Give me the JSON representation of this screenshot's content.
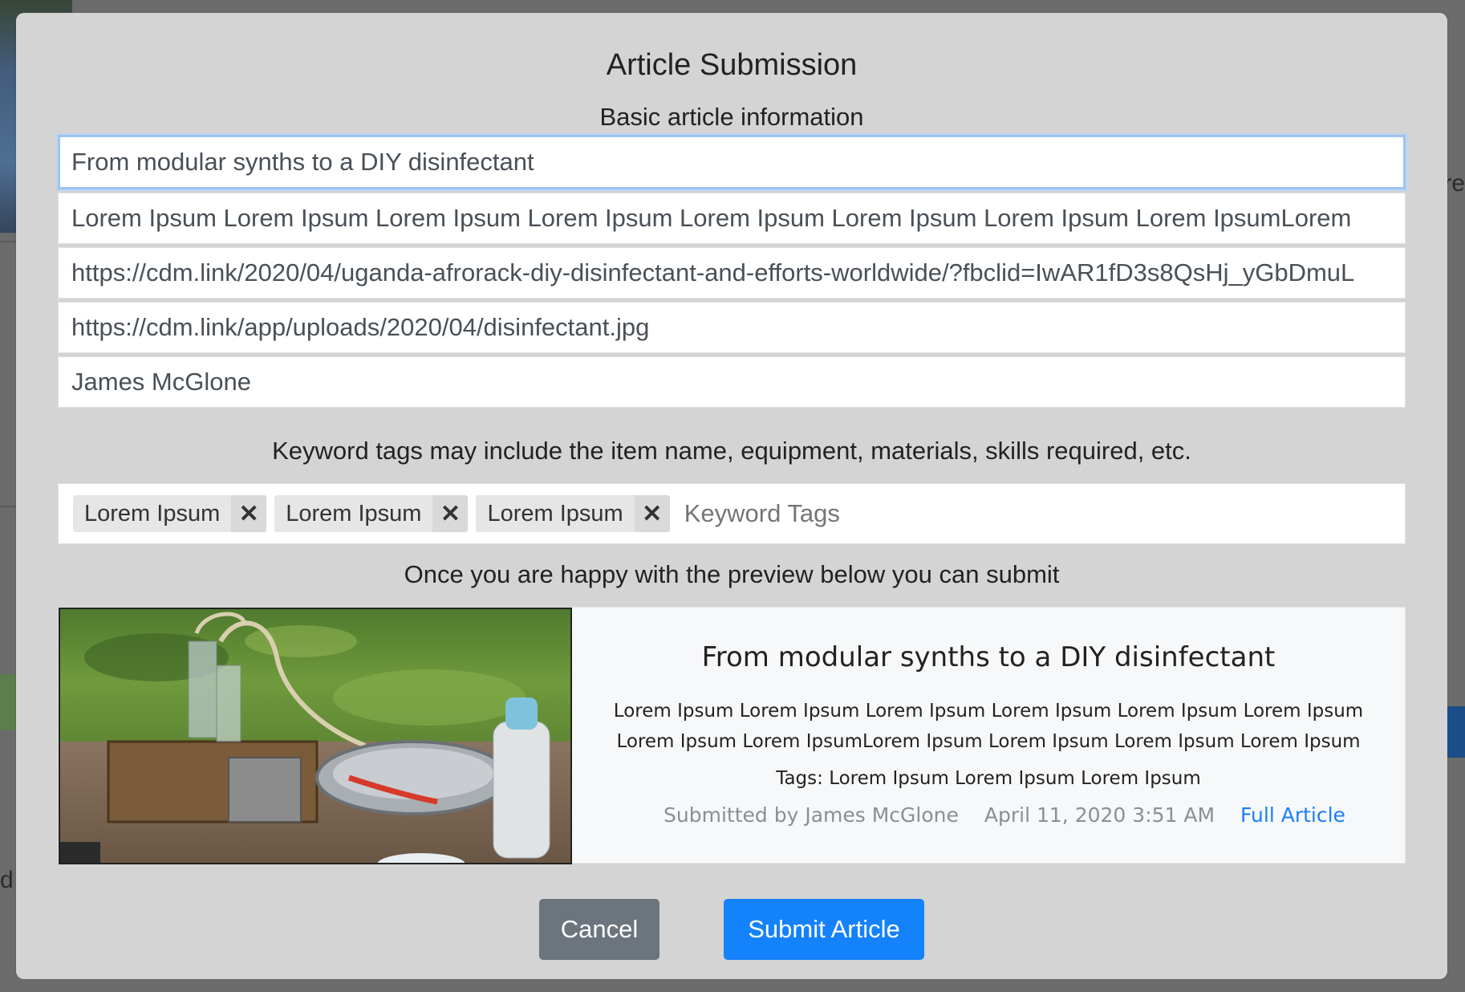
{
  "modal": {
    "title": "Article Submission",
    "subtitle": "Basic article information"
  },
  "fields": {
    "title": "From modular synths to a DIY disinfectant",
    "description": "Lorem Ipsum Lorem Ipsum Lorem Ipsum Lorem Ipsum Lorem Ipsum Lorem Ipsum Lorem Ipsum Lorem IpsumLorem",
    "url": "https://cdm.link/2020/04/uganda-afrorack-diy-disinfectant-and-efforts-worldwide/?fbclid=IwAR1fD3s8QsHj_yGbDmuL",
    "image_url": "https://cdm.link/app/uploads/2020/04/disinfectant.jpg",
    "author": "James McGlone"
  },
  "keywords": {
    "hint": "Keyword tags may include the item name, equipment, materials, skills required, etc.",
    "tags": [
      "Lorem Ipsum",
      "Lorem Ipsum",
      "Lorem Ipsum"
    ],
    "remove_symbol": "✕",
    "placeholder": "Keyword Tags"
  },
  "preview": {
    "hint": "Once you are happy with the preview below you can submit",
    "title": "From modular synths to a DIY disinfectant",
    "description_line1": "Lorem Ipsum Lorem Ipsum Lorem Ipsum Lorem Ipsum Lorem Ipsum Lorem Ipsum",
    "description_line2": "Lorem Ipsum Lorem IpsumLorem Ipsum Lorem Ipsum Lorem Ipsum Lorem Ipsum",
    "tags_line": "Tags: Lorem Ipsum Lorem Ipsum Lorem Ipsum",
    "submitted_by": "Submitted by James McGlone",
    "date": "April 11, 2020 3:51 AM",
    "full_article_link": "Full Article",
    "link_color": "#1a7ff5"
  },
  "buttons": {
    "cancel": "Cancel",
    "submit": "Submit Article",
    "cancel_color": "#6c757d",
    "submit_color": "#1482fa"
  },
  "background": {
    "right_snippet": "re",
    "left_snippet": "d"
  }
}
